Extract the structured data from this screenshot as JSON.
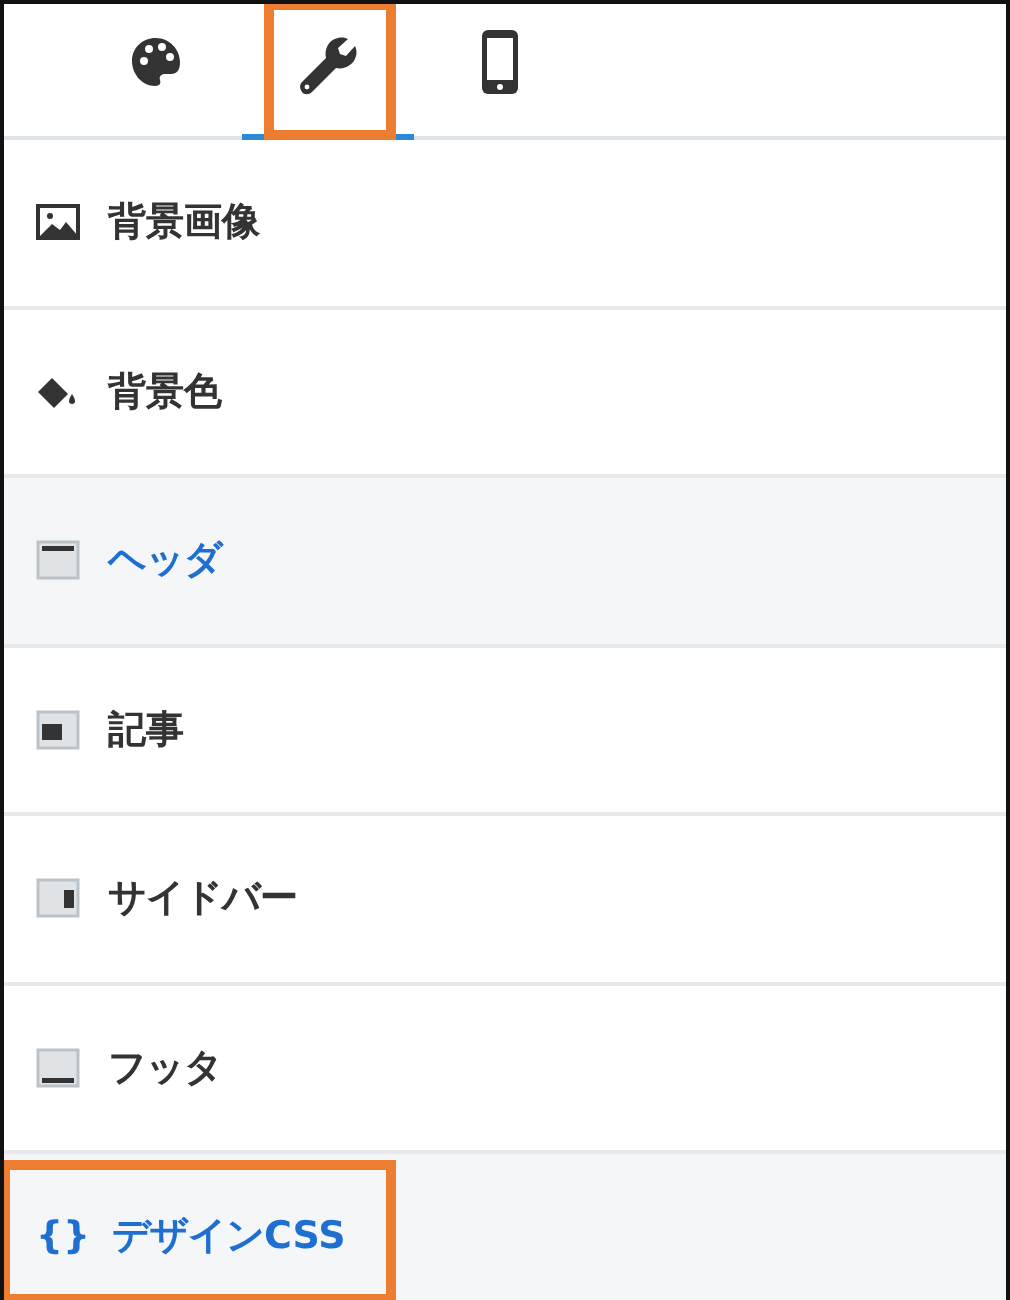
{
  "tabs": [
    {
      "kind": "palette",
      "selected": false,
      "highlighted": false
    },
    {
      "kind": "wrench",
      "selected": true,
      "highlighted": true
    },
    {
      "kind": "phone",
      "selected": false,
      "highlighted": false
    }
  ],
  "items": [
    {
      "kind": "image",
      "label": "背景画像",
      "selected": false,
      "highlighted": false
    },
    {
      "kind": "paint",
      "label": "背景色",
      "selected": false,
      "highlighted": false
    },
    {
      "kind": "layout-header",
      "label": "ヘッダ",
      "selected": true,
      "highlighted": false
    },
    {
      "kind": "layout-article",
      "label": "記事",
      "selected": false,
      "highlighted": false
    },
    {
      "kind": "layout-sidebar",
      "label": "サイドバー",
      "selected": false,
      "highlighted": false
    },
    {
      "kind": "layout-footer",
      "label": "フッタ",
      "selected": false,
      "highlighted": false
    },
    {
      "kind": "code",
      "glyph": "{}",
      "label": "デザインCSS",
      "selected": true,
      "highlighted": true
    }
  ]
}
